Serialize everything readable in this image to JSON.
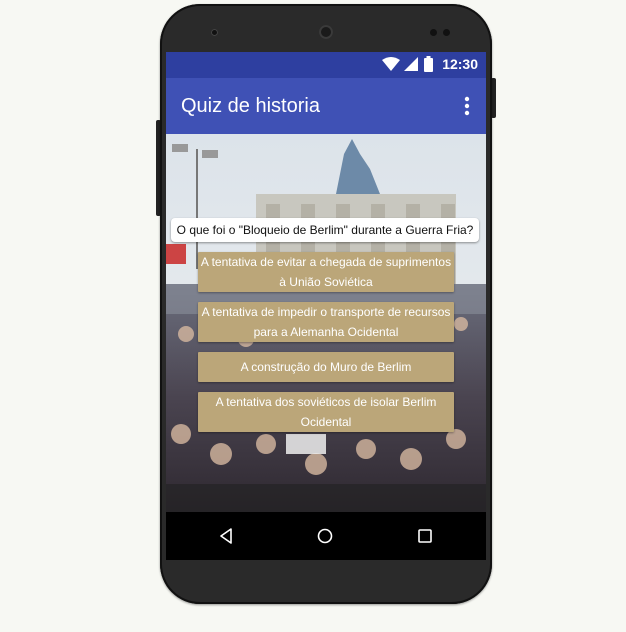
{
  "status_bar": {
    "time": "12:30",
    "icons": [
      "wifi-icon",
      "signal-icon",
      "battery-icon"
    ]
  },
  "app_bar": {
    "title": "Quiz de historia",
    "menu_icon": "overflow-menu-icon"
  },
  "quiz": {
    "question": "O que foi o \"Bloqueio de Berlim\" durante a Guerra Fria?",
    "answers": [
      {
        "label": "A tentativa de evitar a chegada de suprimentos à União Soviética"
      },
      {
        "label": "A tentativa de impedir o transporte de recursos para a Alemanha Ocidental"
      },
      {
        "label": "A construção do Muro de Berlim"
      },
      {
        "label": "A tentativa dos soviéticos de isolar Berlim Ocidental"
      }
    ]
  },
  "nav_bar": {
    "icons": [
      "back-icon",
      "home-icon",
      "recent-apps-icon"
    ]
  },
  "colors": {
    "status_bar": "#2e3fa0",
    "app_bar": "#3f51b5",
    "answer_button": "#bba679",
    "phone_body": "#2a2a2a"
  }
}
